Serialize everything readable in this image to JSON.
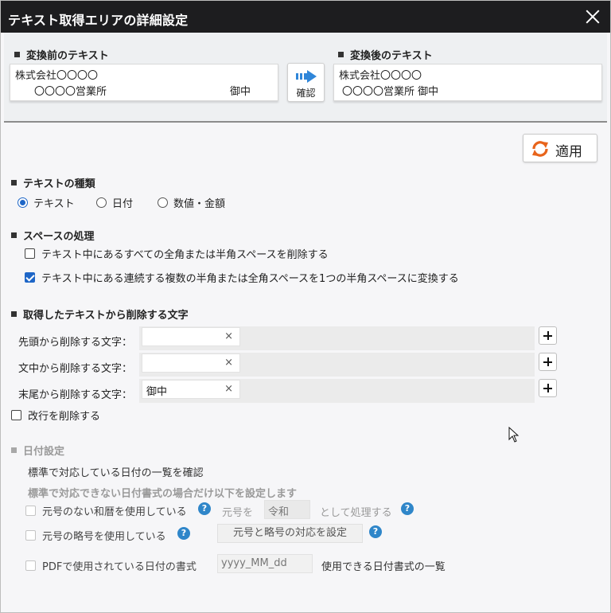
{
  "window": {
    "title": "テキスト取得エリアの詳細設定"
  },
  "preview": {
    "before_heading": "変換前のテキスト",
    "before_line1": "株式会社〇〇〇〇",
    "before_line2_left": "〇〇〇〇営業所",
    "before_line2_right": "御中",
    "confirm_label": "確認",
    "after_heading": "変換後のテキスト",
    "after_line1": "株式会社〇〇〇〇",
    "after_line2": "〇〇〇〇営業所 御中"
  },
  "apply_label": "適用",
  "text_type": {
    "heading": "テキストの種類",
    "options": [
      "テキスト",
      "日付",
      "数値・金額"
    ],
    "selected": "テキスト"
  },
  "space": {
    "heading": "スペースの処理",
    "opt1": {
      "label": "テキスト中にあるすべての全角または半角スペースを削除する",
      "checked": false
    },
    "opt2": {
      "label": "テキスト中にある連続する複数の半角または全角スペースを1つの半角スペースに変換する",
      "checked": true
    }
  },
  "remove": {
    "heading": "取得したテキストから削除する文字",
    "rows": [
      {
        "label": "先頭から削除する文字：",
        "value": ""
      },
      {
        "label": "文中から削除する文字：",
        "value": ""
      },
      {
        "label": "末尾から削除する文字：",
        "value": "御中"
      }
    ],
    "clear_glyph": "×",
    "newline_label": "改行を削除する",
    "newline_checked": false
  },
  "date": {
    "heading": "日付設定",
    "standard_link": "標準で対応している日付の一覧を確認",
    "note": "標準で対応できない日付書式の場合だけ以下を設定します",
    "no_era_label": "元号のない和暦を使用している",
    "era_prefix": "元号を",
    "era_value": "令和",
    "era_suffix": "として処理する",
    "abbr_label": "元号の略号を使用している",
    "abbr_button": "元号と略号の対応を設定",
    "pdf_label": "PDFで使用されている日付の書式",
    "pdf_format": "yyyy_MM_dd",
    "formats_link": "使用できる日付書式の一覧",
    "help_glyph": "?"
  }
}
